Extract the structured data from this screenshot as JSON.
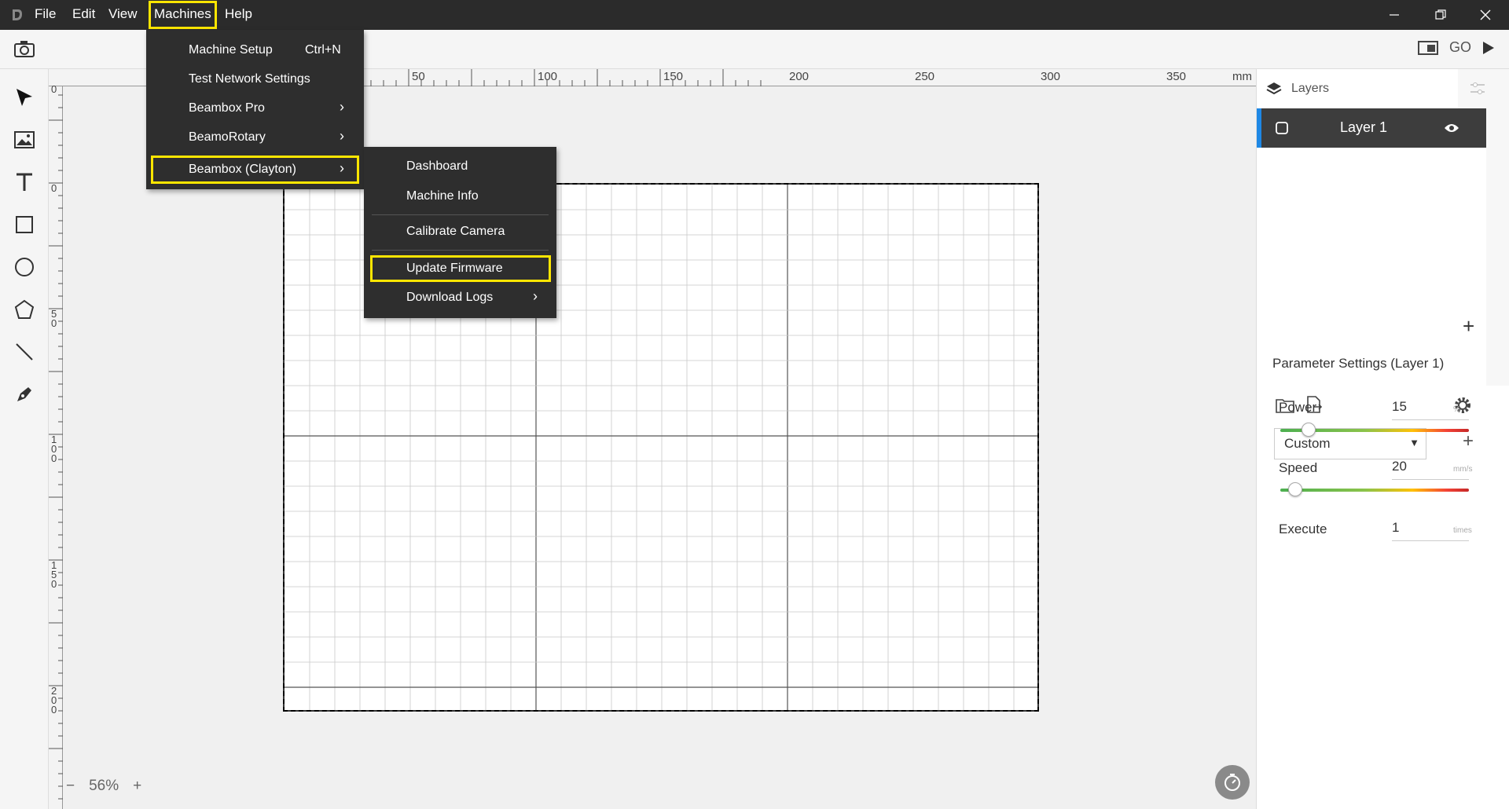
{
  "menubar": {
    "items": [
      "File",
      "Edit",
      "View",
      "Machines",
      "Help"
    ],
    "active": "Machines"
  },
  "toolbar": {
    "go_label": "GO"
  },
  "ruler": {
    "top_labels": [
      "50",
      "100",
      "150",
      "200",
      "250",
      "300",
      "350"
    ],
    "unit": "mm",
    "left_labels": [
      "0",
      "0",
      "50",
      "100",
      "150",
      "200"
    ]
  },
  "machines_menu": {
    "items": [
      {
        "label": "Machine Setup",
        "shortcut": "Ctrl+N",
        "submenu": false
      },
      {
        "label": "Test Network Settings",
        "shortcut": "",
        "submenu": false
      },
      {
        "label": "Beambox Pro",
        "shortcut": "",
        "submenu": true
      },
      {
        "label": "BeamoRotary",
        "shortcut": "",
        "submenu": true
      },
      {
        "label": "Beambox (Clayton)",
        "shortcut": "",
        "submenu": true,
        "highlighted": true
      }
    ]
  },
  "device_submenu": {
    "items": [
      {
        "label": "Dashboard",
        "submenu": false
      },
      {
        "label": "Machine Info",
        "submenu": false
      },
      {
        "label": "Calibrate Camera",
        "submenu": false
      },
      {
        "label": "Update Firmware",
        "submenu": false,
        "highlighted": true
      },
      {
        "label": "Download Logs",
        "submenu": true
      }
    ]
  },
  "zoom": {
    "minus": "−",
    "value": "56%",
    "plus": "+"
  },
  "layers": {
    "header": "Layers",
    "items": [
      {
        "name": "Layer 1",
        "visible": true
      }
    ]
  },
  "parameters": {
    "title": "Parameter Settings (Layer 1)",
    "preset": "Custom",
    "power": {
      "label": "Power",
      "value": "15",
      "unit": "%",
      "fraction": 0.15
    },
    "speed": {
      "label": "Speed",
      "value": "20",
      "unit": "mm/s",
      "fraction": 0.08
    },
    "execute": {
      "label": "Execute",
      "value": "1",
      "unit": "times"
    }
  },
  "colors": {
    "menubar_bg": "#2b2b2b",
    "highlight": "#ffe600",
    "layer_selected": "#3d3d3d",
    "layer_accent": "#1e88e5"
  }
}
